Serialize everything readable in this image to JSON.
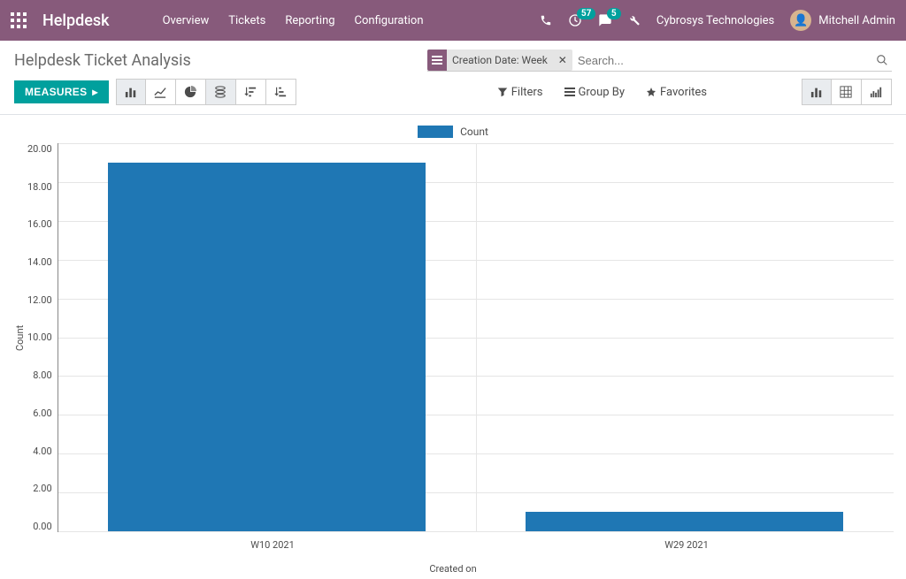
{
  "topnav": {
    "brand": "Helpdesk",
    "menu": [
      "Overview",
      "Tickets",
      "Reporting",
      "Configuration"
    ],
    "activity_badge": "57",
    "messages_badge": "5",
    "company": "Cybrosys Technologies",
    "user_name": "Mitchell Admin"
  },
  "page_title": "Helpdesk Ticket Analysis",
  "search": {
    "facet_label": "Creation Date: Week",
    "placeholder": "Search..."
  },
  "toolbar": {
    "measures_label": "MEASURES",
    "filters_label": "Filters",
    "groupby_label": "Group By",
    "favorites_label": "Favorites"
  },
  "chart_data": {
    "type": "bar",
    "legend": "Count",
    "categories": [
      "W10 2021",
      "W29 2021"
    ],
    "values": [
      19,
      1
    ],
    "xlabel": "Created on",
    "ylabel": "Count",
    "ylim": [
      0,
      20
    ],
    "yticks": [
      "20.00",
      "18.00",
      "16.00",
      "14.00",
      "12.00",
      "10.00",
      "8.00",
      "6.00",
      "4.00",
      "2.00",
      "0.00"
    ]
  }
}
